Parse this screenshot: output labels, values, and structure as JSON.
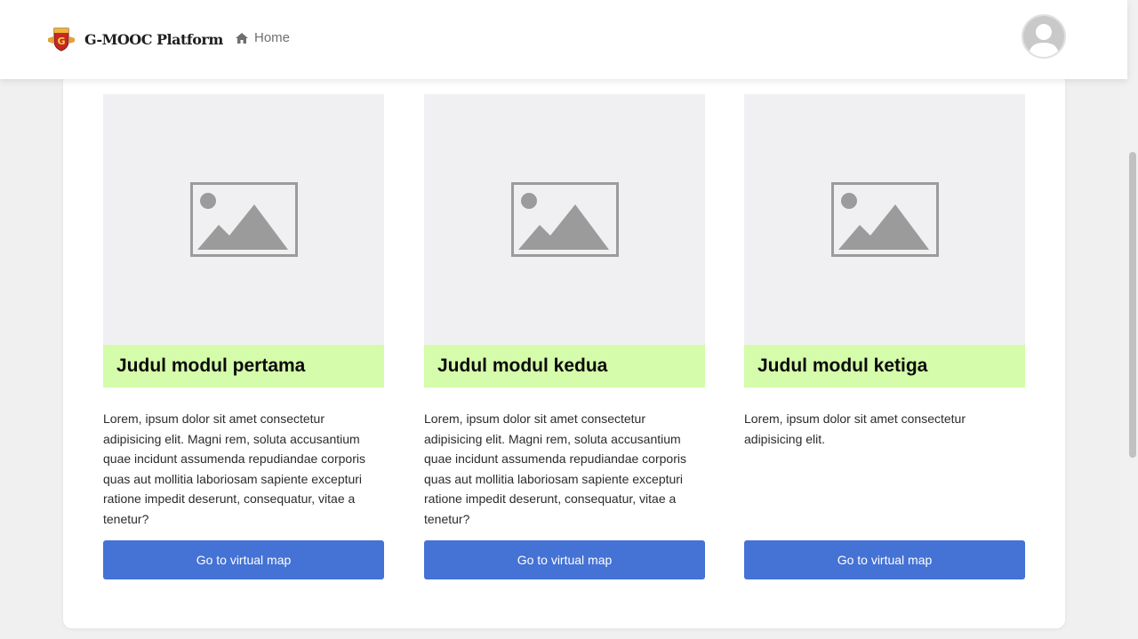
{
  "navbar": {
    "brand_name": "G-MOOC Platform",
    "home_label": "Home"
  },
  "modules": [
    {
      "title": "Judul modul pertama",
      "description": "Lorem, ipsum dolor sit amet consectetur adipisicing elit. Magni rem, soluta accusantium quae incidunt assumenda repudiandae corporis quas aut mollitia laboriosam sapiente excepturi ratione impedit deserunt, consequatur, vitae a tenetur?",
      "button_label": "Go to virtual map"
    },
    {
      "title": "Judul modul kedua",
      "description": "Lorem, ipsum dolor sit amet consectetur adipisicing elit. Magni rem, soluta accusantium quae incidunt assumenda repudiandae corporis quas aut mollitia laboriosam sapiente excepturi ratione impedit deserunt, consequatur, vitae a tenetur?",
      "button_label": "Go to virtual map"
    },
    {
      "title": "Judul modul ketiga",
      "description": "Lorem, ipsum dolor sit amet consectetur adipisicing elit.",
      "button_label": "Go to virtual map"
    }
  ],
  "icons": {
    "brand": "g-mooc-logo-icon",
    "home": "home-icon",
    "avatar": "user-avatar-icon",
    "thumbnail": "image-placeholder-icon"
  },
  "colors": {
    "title_band": "#d4fcaa",
    "button": "#4472d5",
    "background": "#f0f0f1",
    "thumbnail_bg": "#f0f0f2"
  }
}
